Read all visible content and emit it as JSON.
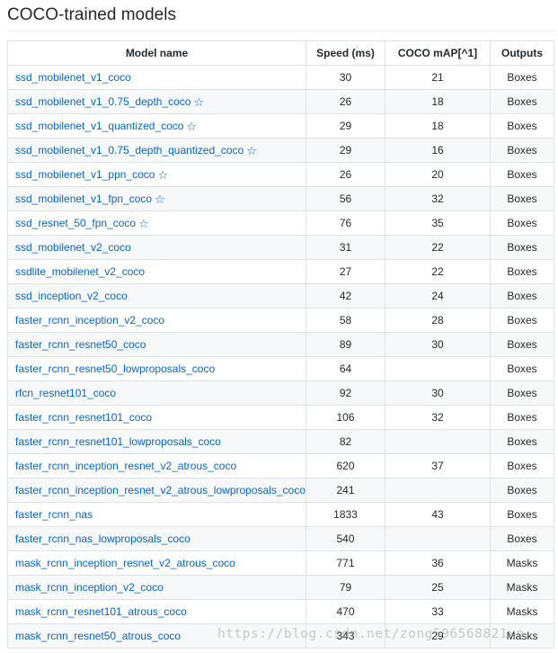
{
  "page": {
    "title": "COCO-trained models",
    "watermark": "https://blog.csdn.net/zong596568821xp"
  },
  "table": {
    "headers": {
      "name": "Model name",
      "speed": "Speed (ms)",
      "map": "COCO mAP[^1]",
      "outputs": "Outputs"
    },
    "star_glyph": "☆",
    "rows": [
      {
        "name": "ssd_mobilenet_v1_coco",
        "star": false,
        "speed": "30",
        "map": "21",
        "outputs": "Boxes"
      },
      {
        "name": "ssd_mobilenet_v1_0.75_depth_coco",
        "star": true,
        "speed": "26",
        "map": "18",
        "outputs": "Boxes"
      },
      {
        "name": "ssd_mobilenet_v1_quantized_coco",
        "star": true,
        "speed": "29",
        "map": "18",
        "outputs": "Boxes"
      },
      {
        "name": "ssd_mobilenet_v1_0.75_depth_quantized_coco",
        "star": true,
        "speed": "29",
        "map": "16",
        "outputs": "Boxes"
      },
      {
        "name": "ssd_mobilenet_v1_ppn_coco",
        "star": true,
        "speed": "26",
        "map": "20",
        "outputs": "Boxes"
      },
      {
        "name": "ssd_mobilenet_v1_fpn_coco",
        "star": true,
        "speed": "56",
        "map": "32",
        "outputs": "Boxes"
      },
      {
        "name": "ssd_resnet_50_fpn_coco",
        "star": true,
        "speed": "76",
        "map": "35",
        "outputs": "Boxes"
      },
      {
        "name": "ssd_mobilenet_v2_coco",
        "star": false,
        "speed": "31",
        "map": "22",
        "outputs": "Boxes"
      },
      {
        "name": "ssdlite_mobilenet_v2_coco",
        "star": false,
        "speed": "27",
        "map": "22",
        "outputs": "Boxes"
      },
      {
        "name": "ssd_inception_v2_coco",
        "star": false,
        "speed": "42",
        "map": "24",
        "outputs": "Boxes"
      },
      {
        "name": "faster_rcnn_inception_v2_coco",
        "star": false,
        "speed": "58",
        "map": "28",
        "outputs": "Boxes"
      },
      {
        "name": "faster_rcnn_resnet50_coco",
        "star": false,
        "speed": "89",
        "map": "30",
        "outputs": "Boxes"
      },
      {
        "name": "faster_rcnn_resnet50_lowproposals_coco",
        "star": false,
        "speed": "64",
        "map": "",
        "outputs": "Boxes"
      },
      {
        "name": "rfcn_resnet101_coco",
        "star": false,
        "speed": "92",
        "map": "30",
        "outputs": "Boxes"
      },
      {
        "name": "faster_rcnn_resnet101_coco",
        "star": false,
        "speed": "106",
        "map": "32",
        "outputs": "Boxes"
      },
      {
        "name": "faster_rcnn_resnet101_lowproposals_coco",
        "star": false,
        "speed": "82",
        "map": "",
        "outputs": "Boxes"
      },
      {
        "name": "faster_rcnn_inception_resnet_v2_atrous_coco",
        "star": false,
        "speed": "620",
        "map": "37",
        "outputs": "Boxes"
      },
      {
        "name": "faster_rcnn_inception_resnet_v2_atrous_lowproposals_coco",
        "star": false,
        "speed": "241",
        "map": "",
        "outputs": "Boxes"
      },
      {
        "name": "faster_rcnn_nas",
        "star": false,
        "speed": "1833",
        "map": "43",
        "outputs": "Boxes"
      },
      {
        "name": "faster_rcnn_nas_lowproposals_coco",
        "star": false,
        "speed": "540",
        "map": "",
        "outputs": "Boxes"
      },
      {
        "name": "mask_rcnn_inception_resnet_v2_atrous_coco",
        "star": false,
        "speed": "771",
        "map": "36",
        "outputs": "Masks"
      },
      {
        "name": "mask_rcnn_inception_v2_coco",
        "star": false,
        "speed": "79",
        "map": "25",
        "outputs": "Masks"
      },
      {
        "name": "mask_rcnn_resnet101_atrous_coco",
        "star": false,
        "speed": "470",
        "map": "33",
        "outputs": "Masks"
      },
      {
        "name": "mask_rcnn_resnet50_atrous_coco",
        "star": false,
        "speed": "343",
        "map": "29",
        "outputs": "Masks"
      }
    ]
  },
  "colors": {
    "link": "#0366d6",
    "border": "#dfe2e5",
    "stripe": "#f6f8fa",
    "text": "#24292e"
  }
}
